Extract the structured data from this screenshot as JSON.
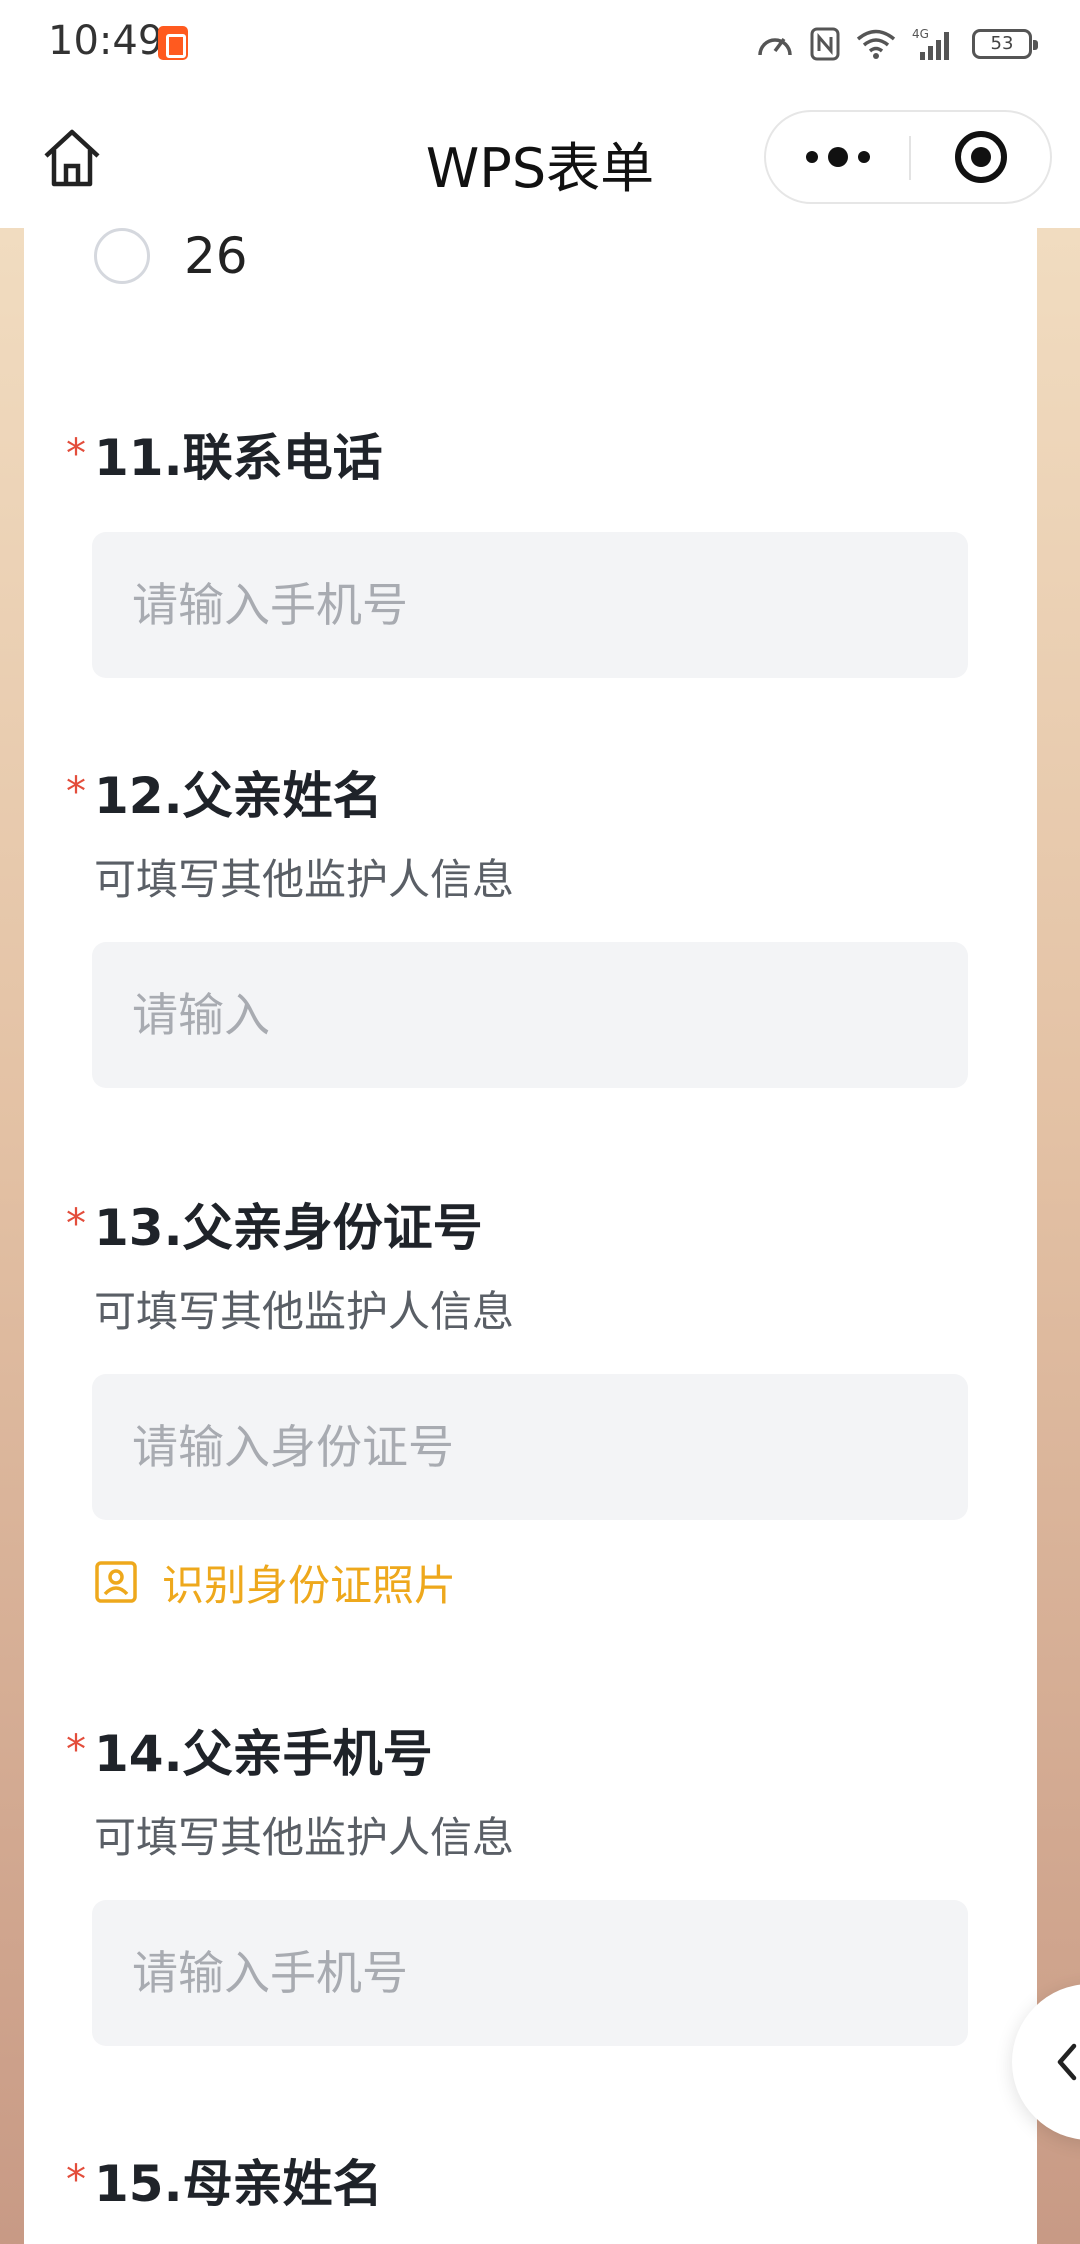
{
  "status_bar": {
    "time": "10:49",
    "battery": "53",
    "icons": [
      "speedometer-icon",
      "nfc-icon",
      "wifi-icon",
      "4g-signal-icon",
      "battery-icon"
    ]
  },
  "navbar": {
    "title": "WPS表单",
    "home_icon": "home-icon",
    "more_icon": "more-dots-icon",
    "close_icon": "target-close-icon"
  },
  "form": {
    "partial_option": {
      "label": "26"
    },
    "questions": [
      {
        "number_title": "11.联系电话",
        "required": "*",
        "description": "",
        "placeholder": "请输入手机号"
      },
      {
        "number_title": "12.父亲姓名",
        "required": "*",
        "description": "可填写其他监护人信息",
        "placeholder": "请输入"
      },
      {
        "number_title": "13.父亲身份证号",
        "required": "*",
        "description": "可填写其他监护人信息",
        "placeholder": "请输入身份证号",
        "recognize_label": "识别身份证照片"
      },
      {
        "number_title": "14.父亲手机号",
        "required": "*",
        "description": "可填写其他监护人信息",
        "placeholder": "请输入手机号"
      },
      {
        "number_title": "15.母亲姓名",
        "required": "*"
      }
    ]
  },
  "colors": {
    "required": "#e34d3b",
    "accent": "#eea81c",
    "input_bg": "#f3f4f6",
    "border_gradient_top": "#f1dcc0",
    "border_gradient_bottom": "#c89a85"
  },
  "side_tab_icon": "chevron-left-icon"
}
